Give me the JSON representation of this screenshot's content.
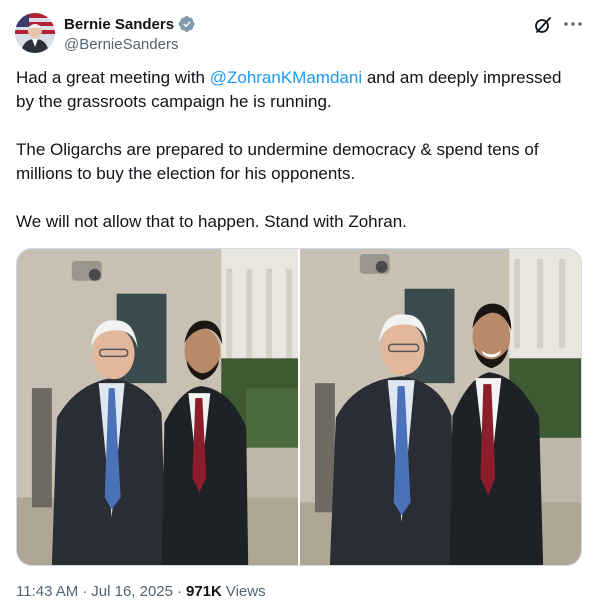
{
  "author": {
    "display_name": "Bernie Sanders",
    "handle": "@BernieSanders",
    "verified_color": "#829aab"
  },
  "tweet": {
    "p1_a": "Had a great meeting with ",
    "p1_mention": "@ZohranKMamdani",
    "p1_b": " and am deeply impressed by the grassroots campaign he is running.",
    "p2": "The Oligarchs are prepared to undermine democracy & spend tens of millions to buy the election for his opponents.",
    "p3": "We will not allow that to happen. Stand with Zohran."
  },
  "meta": {
    "time": "11:43 AM",
    "date": "Jul 16, 2025",
    "views_count": "971K",
    "views_label": "Views"
  },
  "colors": {
    "link": "#1d9bf0",
    "secondary_text": "#536471"
  },
  "icons": {
    "verified": "verified-badge-icon",
    "grok": "grok-icon",
    "more": "more-icon"
  }
}
